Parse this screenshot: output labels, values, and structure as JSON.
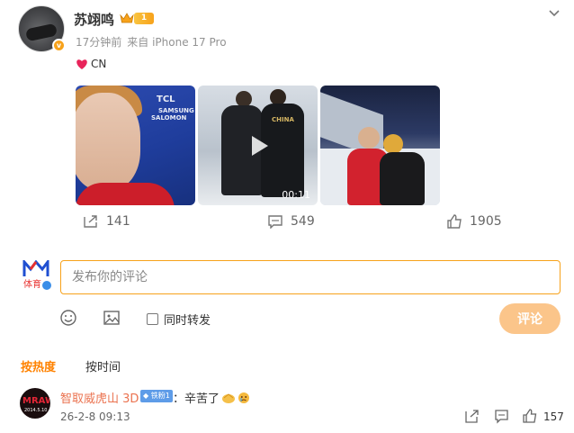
{
  "post": {
    "author": "苏翊鸣",
    "level": "1",
    "time": "17分钟前",
    "source": "来自 iPhone 17 Pro",
    "text": "CN",
    "media": {
      "sponsors": [
        "TCL",
        "SAMSUNG",
        "SALOMON"
      ],
      "jacket_text": "CHINA",
      "video_duration": "00:11"
    },
    "actions": {
      "reposts": "141",
      "comments": "549",
      "likes": "1905"
    }
  },
  "composer": {
    "avatar_text": "体育",
    "placeholder": "发布你的评论",
    "repost_label": "同时转发",
    "submit_label": "评论"
  },
  "sort": {
    "hot": "按热度",
    "time": "按时间"
  },
  "comments": [
    {
      "avatar_text_1": "MRAWFE",
      "avatar_text_2": "2014.5.10",
      "name": "智取威虎山 3D",
      "badge": "铁粉1",
      "text": "：辛苦了",
      "time": "26-2-8 09:13",
      "likes": "157"
    }
  ],
  "colors": {
    "accent": "#ff8200",
    "input_border": "#f7a21b",
    "submit_disabled": "#fbc58a",
    "name_link": "#eb7350"
  }
}
